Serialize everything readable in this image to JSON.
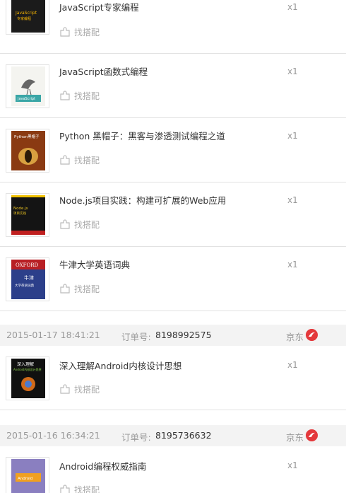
{
  "items_group1": [
    {
      "title": "JavaScript专家编程",
      "qty": "x1",
      "match_label": "找搭配",
      "cover_text": "JavaScript专家编程"
    },
    {
      "title": "JavaScript函数式编程",
      "qty": "x1",
      "match_label": "找搭配",
      "cover_text": "JavaScript函数式编程"
    },
    {
      "title": "Python 黑帽子：黑客与渗透测试编程之道",
      "qty": "x1",
      "match_label": "找搭配",
      "cover_text": "Python黑帽子"
    },
    {
      "title": "Node.js项目实践：构建可扩展的Web应用",
      "qty": "x1",
      "match_label": "找搭配",
      "cover_text": "Node.js项目实践"
    },
    {
      "title": "牛津大学英语词典",
      "qty": "x1",
      "match_label": "找搭配",
      "cover_text": "OXFORD 牛津 大学英语词典"
    }
  ],
  "orders": [
    {
      "date": "2015-01-17 18:41:21",
      "order_label": "订单号:",
      "order_no": "8198992575",
      "shop": "京东",
      "item": {
        "title": "深入理解Android内核设计思想",
        "qty": "x1",
        "match_label": "找搭配",
        "cover_text": "深入理解 Android内核设计思想"
      }
    },
    {
      "date": "2015-01-16 16:34:21",
      "order_label": "订单号:",
      "order_no": "8195736632",
      "shop": "京东",
      "item": {
        "title": "Android编程权威指南",
        "qty": "x1",
        "match_label": "找搭配",
        "cover_text": "Android编程权威指南"
      }
    }
  ],
  "colors": {
    "jd_red": "#e4393c",
    "header_bg": "#f3f3f3"
  }
}
